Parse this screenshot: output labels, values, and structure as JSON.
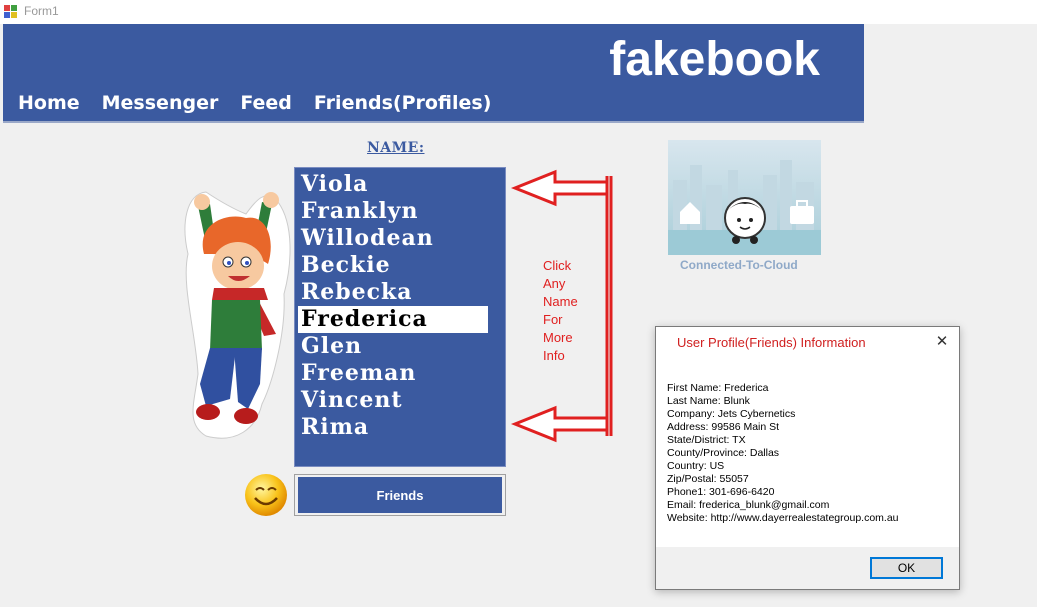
{
  "window": {
    "title": "Form1"
  },
  "header": {
    "brand": "fakebook",
    "nav": [
      "Home",
      "Messenger",
      "Feed",
      "Friends(Profiles)"
    ]
  },
  "name_label": "NAME:",
  "friends_list": {
    "items": [
      "Viola",
      "Franklyn",
      "Willodean",
      "Beckie",
      "Rebecka",
      "Frederica",
      "Glen",
      "Freeman",
      "Vincent",
      "Rima"
    ],
    "selected": "Frederica"
  },
  "friends_button": "Friends",
  "hint_lines": [
    "Click",
    "Any",
    "Name",
    "For",
    "More",
    "Info"
  ],
  "cloud_label": "Connected-To-Cloud",
  "dialog": {
    "title": "User Profile(Friends) Information",
    "close_icon": "close-icon",
    "lines": [
      "First Name: Frederica",
      "Last Name: Blunk",
      "Company: Jets Cybernetics",
      "Address: 99586 Main St",
      "State/District: TX",
      "County/Province: Dallas",
      "Country: US",
      "Zip/Postal: 55057",
      "Phone1: 301-696-6420",
      "Email: frederica_blunk@gmail.com",
      "Website: http://www.dayerrealestategroup.com.au"
    ],
    "ok_label": "OK"
  },
  "colors": {
    "brand_blue": "#3b5aa0",
    "hint_red": "#e02020",
    "dialog_title_red": "#d02020",
    "cloud_label": "#8fa9c8"
  }
}
